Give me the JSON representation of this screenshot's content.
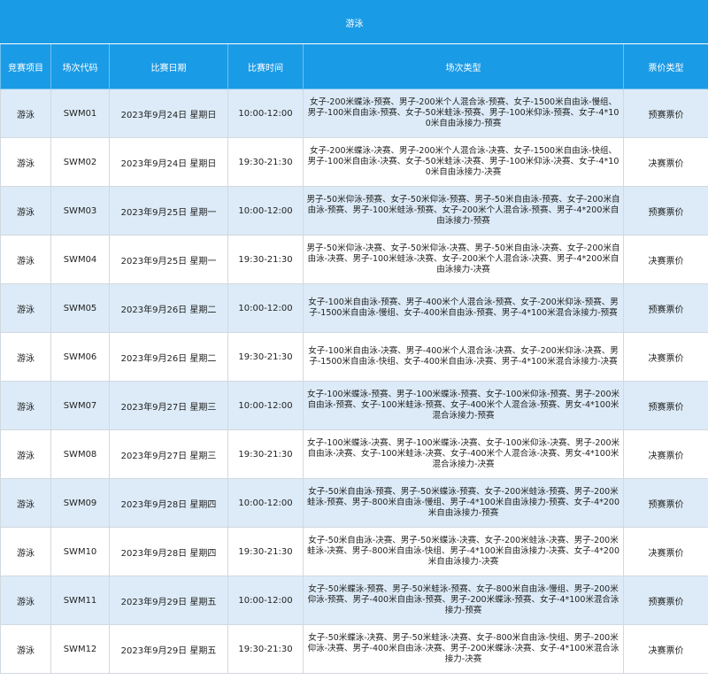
{
  "title": "游泳",
  "columns": [
    "竞赛项目",
    "场次代码",
    "比赛日期",
    "比赛时间",
    "场次类型",
    "票价类型"
  ],
  "rows": [
    {
      "sport": "游泳",
      "code": "SWM01",
      "date": "2023年9月24日 星期日",
      "time": "10:00-12:00",
      "events": "女子-200米蝶泳-预赛、男子-200米个人混合泳-预赛、女子-1500米自由泳-慢组、男子-100米自由泳-预赛、女子-50米蛙泳-预赛、男子-100米仰泳-预赛、女子-4*100米自由泳接力-预赛",
      "ticket": "预赛票价"
    },
    {
      "sport": "游泳",
      "code": "SWM02",
      "date": "2023年9月24日 星期日",
      "time": "19:30-21:30",
      "events": "女子-200米蝶泳-决赛、男子-200米个人混合泳-决赛、女子-1500米自由泳-快组、男子-100米自由泳-决赛、女子-50米蛙泳-决赛、男子-100米仰泳-决赛、女子-4*100米自由泳接力-决赛",
      "ticket": "决赛票价"
    },
    {
      "sport": "游泳",
      "code": "SWM03",
      "date": "2023年9月25日 星期一",
      "time": "10:00-12:00",
      "events": "男子-50米仰泳-预赛、女子-50米仰泳-预赛、男子-50米自由泳-预赛、女子-200米自由泳-预赛、男子-100米蛙泳-预赛、女子-200米个人混合泳-预赛、男子-4*200米自由泳接力-预赛",
      "ticket": "预赛票价"
    },
    {
      "sport": "游泳",
      "code": "SWM04",
      "date": "2023年9月25日 星期一",
      "time": "19:30-21:30",
      "events": "男子-50米仰泳-决赛、女子-50米仰泳-决赛、男子-50米自由泳-决赛、女子-200米自由泳-决赛、男子-100米蛙泳-决赛、女子-200米个人混合泳-决赛、男子-4*200米自由泳接力-决赛",
      "ticket": "决赛票价"
    },
    {
      "sport": "游泳",
      "code": "SWM05",
      "date": "2023年9月26日 星期二",
      "time": "10:00-12:00",
      "events": "女子-100米自由泳-预赛、男子-400米个人混合泳-预赛、女子-200米仰泳-预赛、男子-1500米自由泳-慢组、女子-400米自由泳-预赛、男子-4*100米混合泳接力-预赛",
      "ticket": "预赛票价"
    },
    {
      "sport": "游泳",
      "code": "SWM06",
      "date": "2023年9月26日 星期二",
      "time": "19:30-21:30",
      "events": "女子-100米自由泳-决赛、男子-400米个人混合泳-决赛、女子-200米仰泳-决赛、男子-1500米自由泳-快组、女子-400米自由泳-决赛、男子-4*100米混合泳接力-决赛",
      "ticket": "决赛票价"
    },
    {
      "sport": "游泳",
      "code": "SWM07",
      "date": "2023年9月27日 星期三",
      "time": "10:00-12:00",
      "events": "女子-100米蝶泳-预赛、男子-100米蝶泳-预赛、女子-100米仰泳-预赛、男子-200米自由泳-预赛、女子-100米蛙泳-预赛、女子-400米个人混合泳-预赛、男女-4*100米混合泳接力-预赛",
      "ticket": "预赛票价"
    },
    {
      "sport": "游泳",
      "code": "SWM08",
      "date": "2023年9月27日 星期三",
      "time": "19:30-21:30",
      "events": "女子-100米蝶泳-决赛、男子-100米蝶泳-决赛、女子-100米仰泳-决赛、男子-200米自由泳-决赛、女子-100米蛙泳-决赛、女子-400米个人混合泳-决赛、男女-4*100米混合泳接力-决赛",
      "ticket": "决赛票价"
    },
    {
      "sport": "游泳",
      "code": "SWM09",
      "date": "2023年9月28日 星期四",
      "time": "10:00-12:00",
      "events": "女子-50米自由泳-预赛、男子-50米蝶泳-预赛、女子-200米蛙泳-预赛、男子-200米蛙泳-预赛、男子-800米自由泳-慢组、男子-4*100米自由泳接力-预赛、女子-4*200米自由泳接力-预赛",
      "ticket": "预赛票价"
    },
    {
      "sport": "游泳",
      "code": "SWM10",
      "date": "2023年9月28日 星期四",
      "time": "19:30-21:30",
      "events": "女子-50米自由泳-决赛、男子-50米蝶泳-决赛、女子-200米蛙泳-决赛、男子-200米蛙泳-决赛、男子-800米自由泳-快组、男子-4*100米自由泳接力-决赛、女子-4*200米自由泳接力-决赛",
      "ticket": "决赛票价"
    },
    {
      "sport": "游泳",
      "code": "SWM11",
      "date": "2023年9月29日 星期五",
      "time": "10:00-12:00",
      "events": "女子-50米蝶泳-预赛、男子-50米蛙泳-预赛、女子-800米自由泳-慢组、男子-200米仰泳-预赛、男子-400米自由泳-预赛、男子-200米蝶泳-预赛、女子-4*100米混合泳接力-预赛",
      "ticket": "预赛票价"
    },
    {
      "sport": "游泳",
      "code": "SWM12",
      "date": "2023年9月29日 星期五",
      "time": "19:30-21:30",
      "events": "女子-50米蝶泳-决赛、男子-50米蛙泳-决赛、女子-800米自由泳-快组、男子-200米仰泳-决赛、男子-400米自由泳-决赛、男子-200米蝶泳-决赛、女子-4*100米混合泳接力-决赛",
      "ticket": "决赛票价"
    }
  ]
}
